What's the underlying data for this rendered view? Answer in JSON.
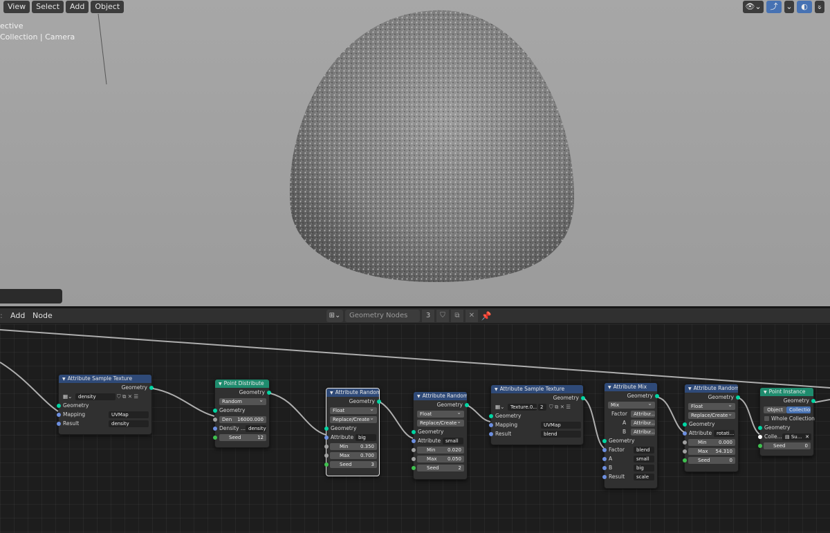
{
  "viewport": {
    "menu": [
      "View",
      "Select",
      "Add",
      "Object"
    ],
    "info_line1": "ective",
    "info_line2": "Collection | Camera",
    "right_icons": [
      "visibility-icon",
      "gizmo-icon",
      "overlay-icon"
    ]
  },
  "node_editor": {
    "menu": [
      "Add",
      "Node"
    ],
    "tree_name": "Geometry Nodes",
    "user_count": "3"
  },
  "nodes": {
    "ast1": {
      "title": "Attribute Sample Texture",
      "out_geometry": "Geometry",
      "texture": "density",
      "in_geometry": "Geometry",
      "mapping_label": "Mapping",
      "mapping": "UVMap",
      "result_label": "Result",
      "result": "density"
    },
    "pd": {
      "title": "Point Distribute",
      "out_geometry": "Geometry",
      "mode": "Random",
      "in_geometry": "Geometry",
      "den_label": "Den",
      "den_value": "16000.000",
      "density_label": "Density ...",
      "density_attr": "density",
      "seed_label": "Seed",
      "seed": "12"
    },
    "ar1": {
      "title": "Attribute Randomi...",
      "out_geometry": "Geometry",
      "type": "Float",
      "op": "Replace/Create",
      "in_geometry": "Geometry",
      "attr_label": "Attribute",
      "attr": "big",
      "min_label": "Min",
      "min": "0.350",
      "max_label": "Max",
      "max": "0.700",
      "seed_label": "Seed",
      "seed": "3"
    },
    "ar2": {
      "title": "Attribute Randomi...",
      "out_geometry": "Geometry",
      "type": "Float",
      "op": "Replace/Create",
      "in_geometry": "Geometry",
      "attr_label": "Attribute",
      "attr": "small",
      "min_label": "Min",
      "min": "0.020",
      "max_label": "Max",
      "max": "0.050",
      "seed_label": "Seed",
      "seed": "2"
    },
    "ast2": {
      "title": "Attribute Sample Texture",
      "out_geometry": "Geometry",
      "texture": "Texture.0...",
      "users": "2",
      "in_geometry": "Geometry",
      "mapping_label": "Mapping",
      "mapping": "UVMap",
      "result_label": "Result",
      "result": "blend"
    },
    "am": {
      "title": "Attribute Mix",
      "out_geometry": "Geometry",
      "blend": "Mix",
      "factor_label": "Factor",
      "factor_mode": "Attribu...",
      "a_label": "A",
      "a_mode": "Attribu...",
      "b_label": "B",
      "b_mode": "Attribu...",
      "in_geometry": "Geometry",
      "factor_attr": "blend",
      "a_attr": "small",
      "b_attr": "big",
      "result_label": "Result",
      "result": "scale"
    },
    "ar3": {
      "title": "Attribute Randomi...",
      "out_geometry": "Geometry",
      "type": "Float",
      "op": "Replace/Create",
      "in_geometry": "Geometry",
      "attr_label": "Attribute",
      "attr": "rotati...",
      "min_label": "Min",
      "min": "0.000",
      "max_label": "Max",
      "max": "54.310",
      "seed_label": "Seed",
      "seed": "0"
    },
    "pi": {
      "title": "Point Instance",
      "out_geometry": "Geometry",
      "mode_object": "Object",
      "mode_collection": "Collection",
      "whole_collection": "Whole Collection",
      "in_geometry": "Geometry",
      "collection_label": "Colle...",
      "collection_value": "Su...",
      "seed_label": "Seed",
      "seed": "0"
    }
  }
}
